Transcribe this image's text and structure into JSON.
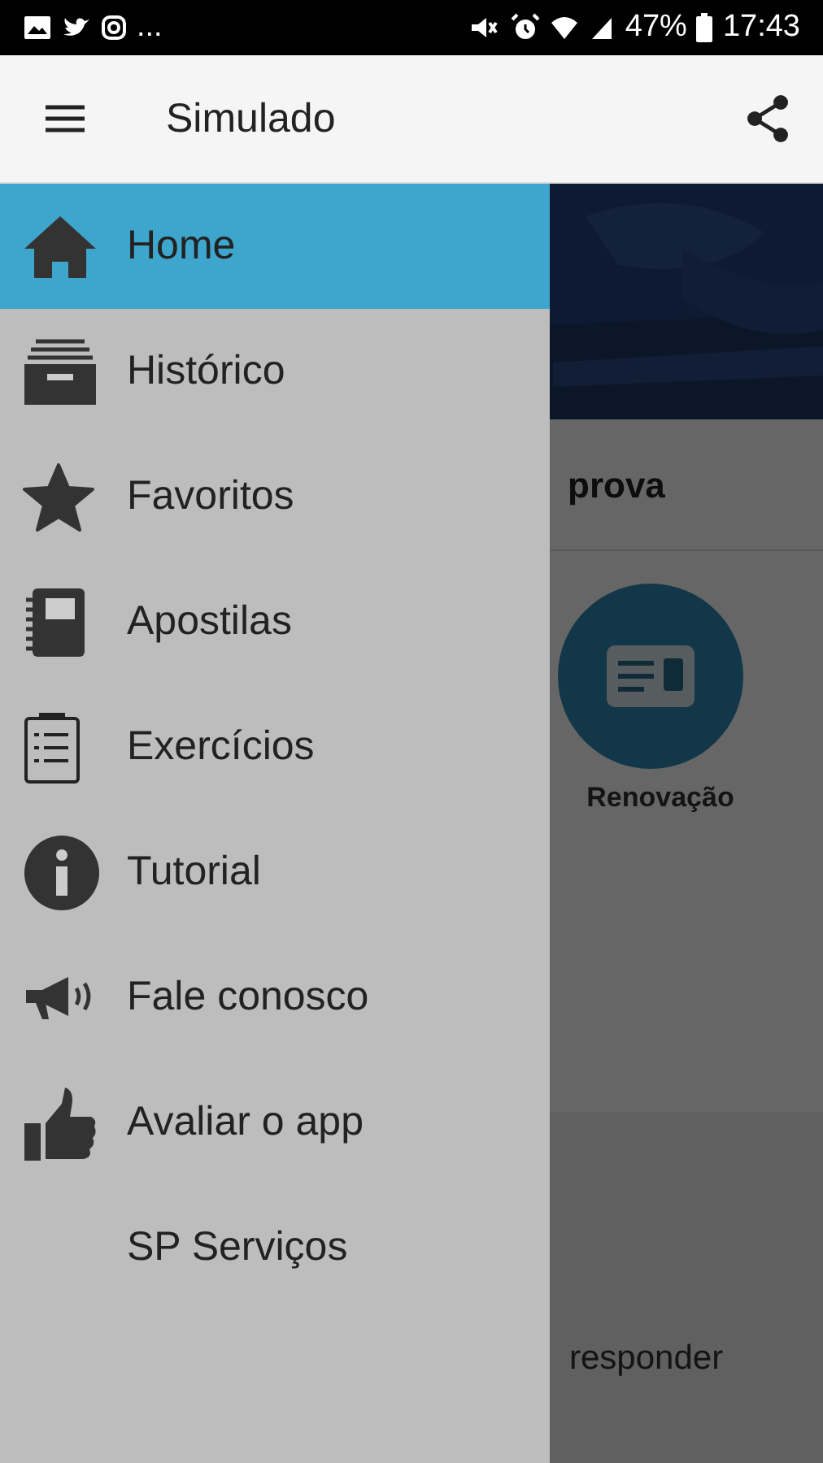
{
  "status_bar": {
    "more": "...",
    "battery": "47%",
    "time": "17:43"
  },
  "app_bar": {
    "title": "Simulado"
  },
  "content": {
    "heading": "prova",
    "options": [
      {
        "label": "Renovação"
      }
    ],
    "description": "responder"
  },
  "drawer": {
    "items": [
      {
        "label": "Home",
        "selected": true
      },
      {
        "label": "Histórico",
        "selected": false
      },
      {
        "label": "Favoritos",
        "selected": false
      },
      {
        "label": "Apostilas",
        "selected": false
      },
      {
        "label": "Exercícios",
        "selected": false
      },
      {
        "label": "Tutorial",
        "selected": false
      },
      {
        "label": "Fale conosco",
        "selected": false
      },
      {
        "label": "Avaliar o app",
        "selected": false
      },
      {
        "label": "SP Serviços",
        "selected": false
      }
    ]
  }
}
